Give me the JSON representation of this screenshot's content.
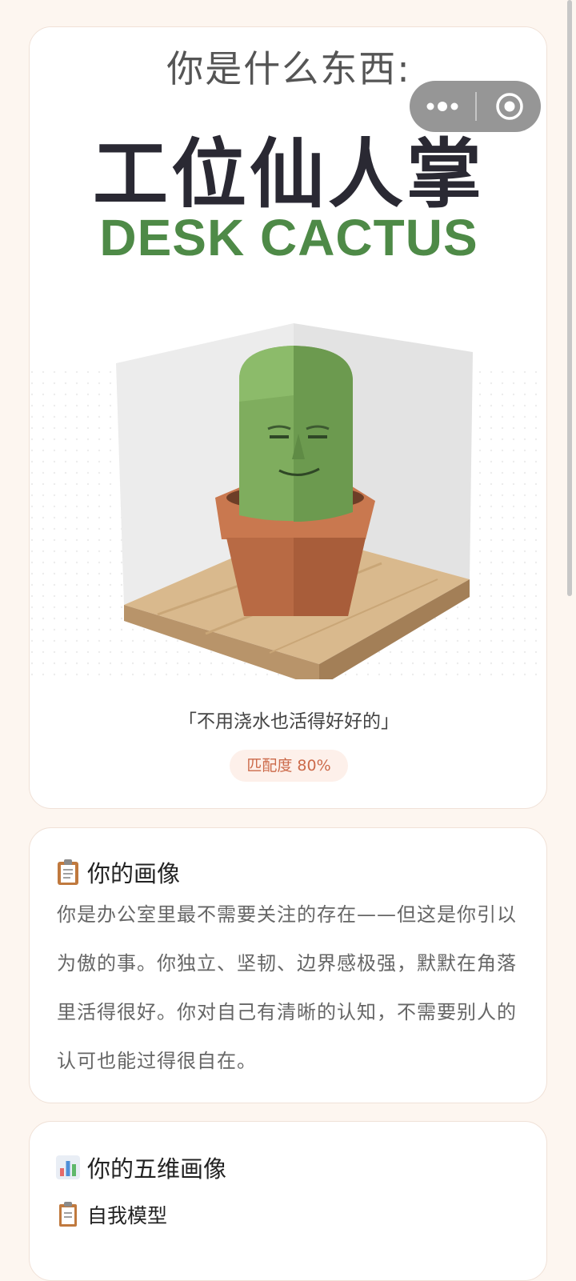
{
  "result": {
    "prefix": "你是什么东西:",
    "name_cn": "工位仙人掌",
    "name_en": "DESK CACTUS",
    "quote": "「不用浇水也活得好好的」",
    "match_label": "匹配度 80%",
    "match_percent": 80
  },
  "portrait": {
    "icon": "clipboard-icon",
    "title": "你的画像",
    "body": "你是办公室里最不需要关注的存在——但这是你引以为傲的事。你独立、坚韧、边界感极强，默默在角落里活得很好。你对自己有清晰的认知，不需要别人的认可也能过得很自在。"
  },
  "dimensions": {
    "icon": "bar-chart-icon",
    "title": "你的五维画像",
    "items": [
      {
        "icon": "notepad-icon",
        "label": "自我模型"
      }
    ]
  },
  "capsule": {
    "more_icon": "more-dots-icon",
    "close_icon": "target-close-icon"
  },
  "colors": {
    "background": "#fdf6f0",
    "accent_green": "#4e8a47",
    "accent_orange": "#cc6a4a"
  }
}
